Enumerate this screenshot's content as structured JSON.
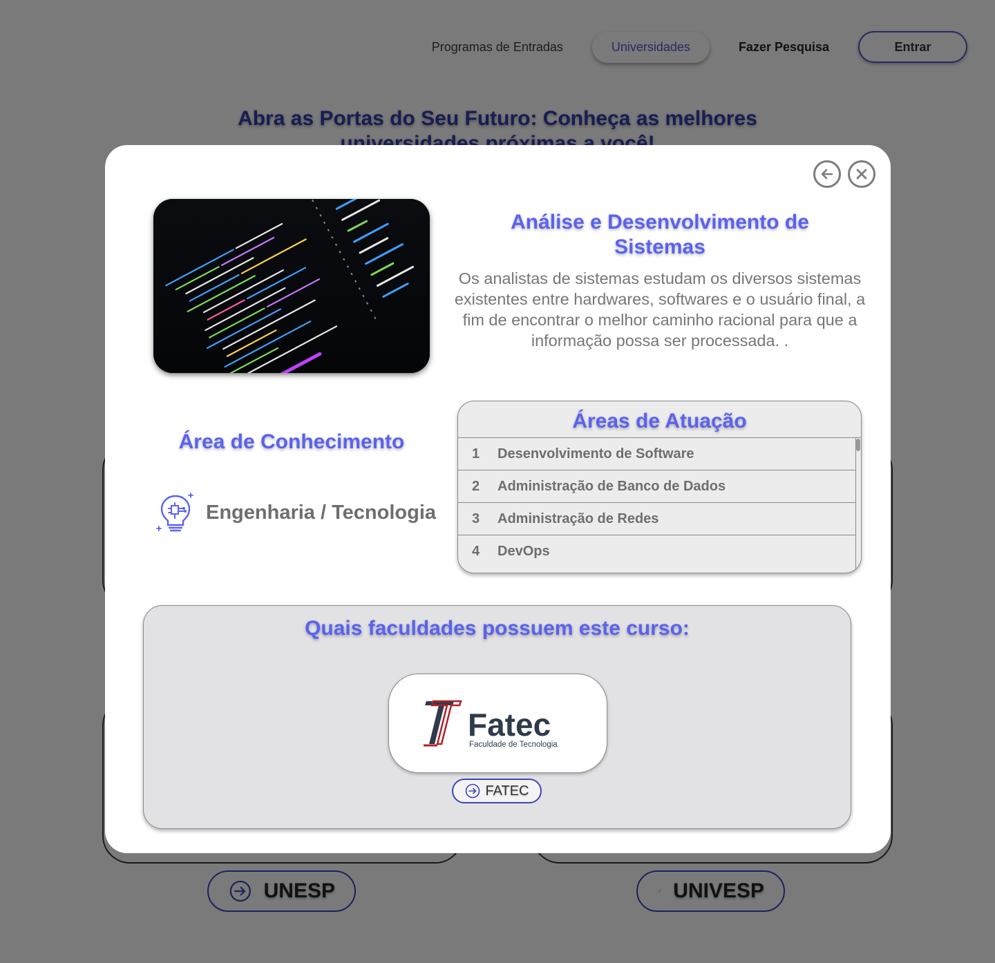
{
  "nav": {
    "programs": "Programas de Entradas",
    "universities": "Universidades",
    "research": "Fazer Pesquisa",
    "login": "Entrar"
  },
  "hero": {
    "title": "Abra as Portas do Seu Futuro: Conheça as melhores universidades próximas a você!"
  },
  "background_buttons": [
    "UNESP",
    "UNIVESP"
  ],
  "modal": {
    "course_title": "Análise e Desenvolvimento de Sistemas",
    "course_description": "Os analistas de sistemas estudam os diversos sistemas existentes entre hardwares, softwares e o usuário final, a fim de encontrar o melhor caminho racional para que a informação possa ser processada. .",
    "knowledge_title": "Área de Conhecimento",
    "knowledge_area": "Engenharia / Tecnologia",
    "areas_title": "Áreas de Atuação",
    "areas": [
      {
        "num": "1",
        "label": "Desenvolvimento de Software"
      },
      {
        "num": "2",
        "label": "Administração de Banco de Dados"
      },
      {
        "num": "3",
        "label": "Administração de Redes"
      },
      {
        "num": "4",
        "label": "DevOps"
      }
    ],
    "schools_title": "Quais faculdades possuem este curso:",
    "school_logo_name": "Fatec",
    "school_logo_subtitle": "Faculdade de Tecnologia",
    "school_button": "FATEC"
  },
  "colors": {
    "accent": "#5a62f0",
    "brand_blue": "#3a45b8",
    "fatec_red": "#b51f24",
    "fatec_dark": "#2f3b4c"
  }
}
